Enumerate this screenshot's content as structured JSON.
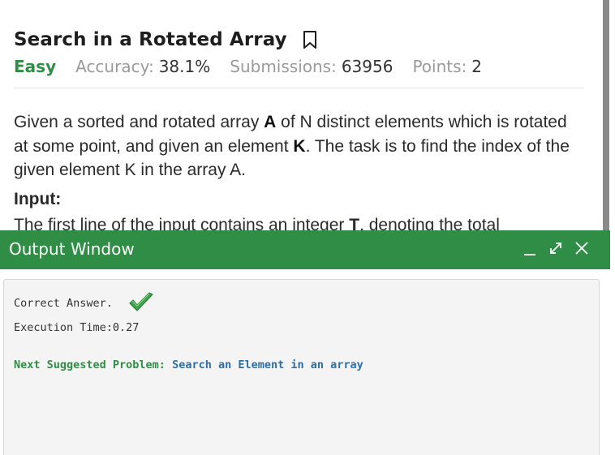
{
  "problem": {
    "title": "Search in a Rotated Array",
    "difficulty": "Easy",
    "accuracy_label": "Accuracy:",
    "accuracy_value": "38.1%",
    "submissions_label": "Submissions:",
    "submissions_value": "63956",
    "points_label": "Points:",
    "points_value": "2",
    "statement": {
      "part1": "Given a sorted and rotated array ",
      "bold1": "A",
      "part2": " of N distinct elements which is rotated at some point, and given an element ",
      "bold2": "K",
      "part3": ". The task is to find the index of the given element K in the array A."
    },
    "input_heading": "Input:",
    "input_text_prefix": "The first line of the input contains an integer ",
    "input_text_bold": "T",
    "input_text_suffix": ", denoting the total"
  },
  "output_window": {
    "title": "Output Window",
    "result_text": "Correct Answer.",
    "execution_time": "Execution Time:0.27",
    "next_label": "Next Suggested Problem:",
    "next_link": "Search an Element in an array"
  },
  "colors": {
    "brand_green": "#2f8d46",
    "link_blue": "#2c6fa8"
  },
  "icons": [
    "bookmark-icon",
    "minimize-icon",
    "expand-icon",
    "close-icon",
    "checkmark-icon"
  ]
}
